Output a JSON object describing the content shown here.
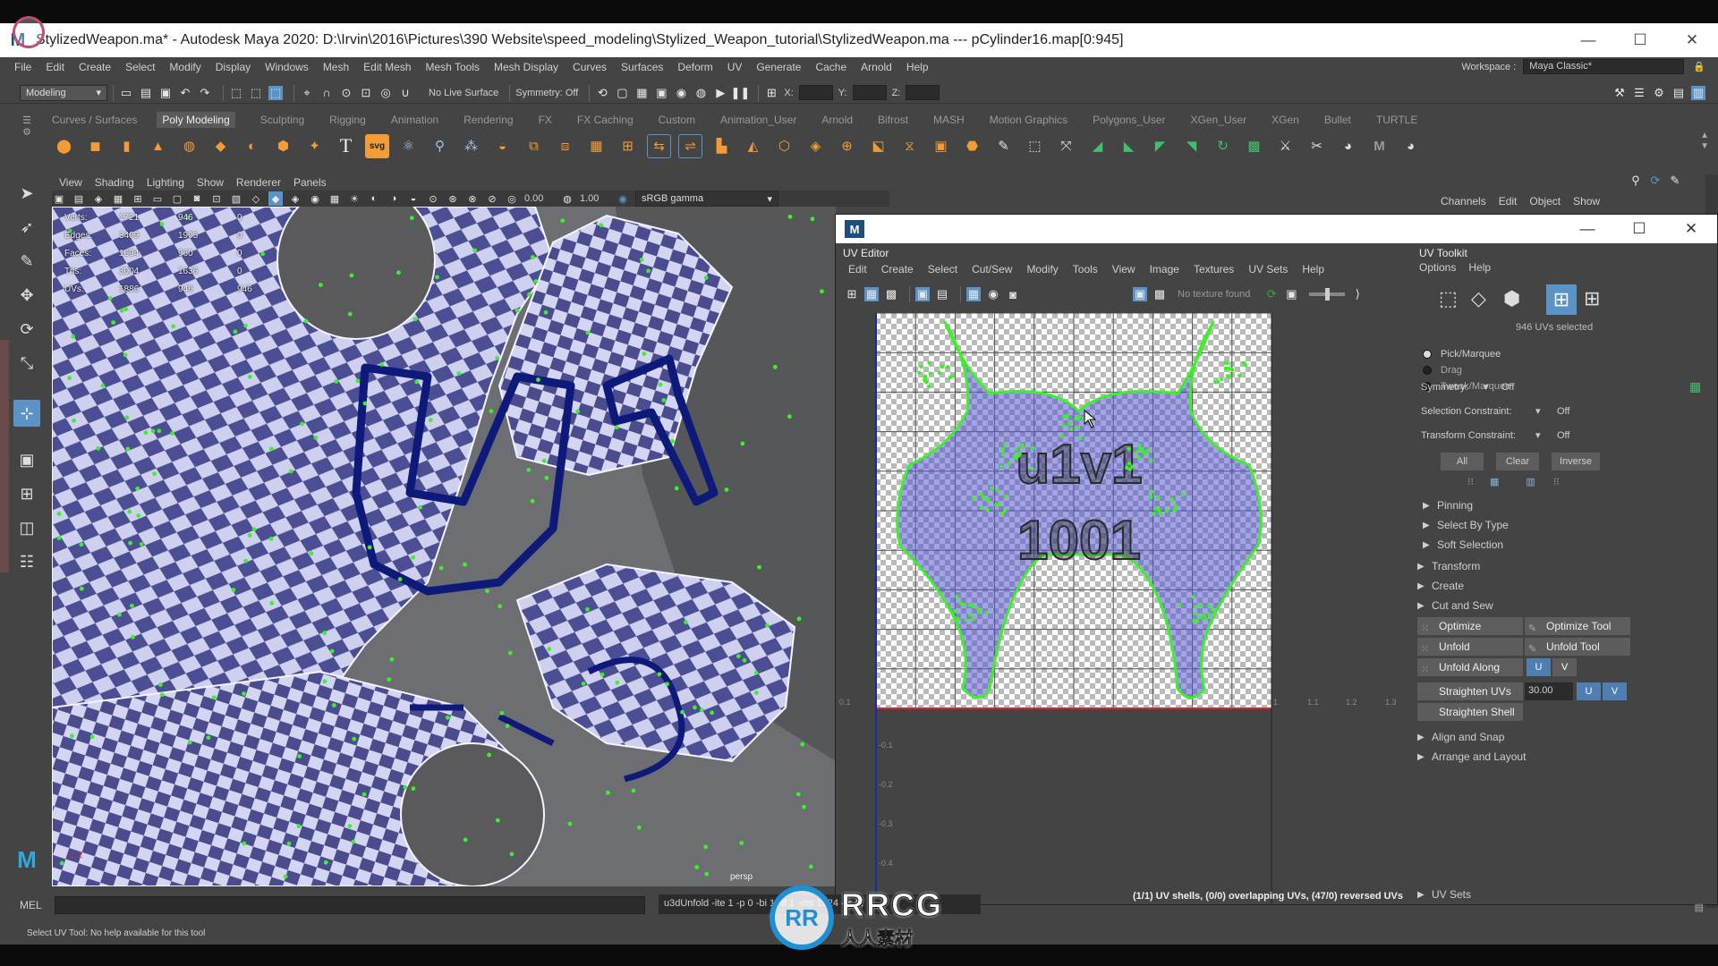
{
  "window": {
    "title": "StylizedWeapon.ma* - Autodesk Maya 2020: D:\\Irvin\\2016\\Pictures\\390 Website\\speed_modeling\\Stylized_Weapon_tutorial\\StylizedWeapon.ma  ---  pCylinder16.map[0:945]",
    "minimize": "—",
    "maximize": "☐",
    "close": "✕",
    "logo": "M"
  },
  "menubar": {
    "items": [
      "File",
      "Edit",
      "Create",
      "Select",
      "Modify",
      "Display",
      "Windows",
      "Mesh",
      "Edit Mesh",
      "Mesh Tools",
      "Mesh Display",
      "Curves",
      "Surfaces",
      "Deform",
      "UV",
      "Generate",
      "Cache",
      "Arnold",
      "Help"
    ],
    "workspace_label": "Workspace :",
    "workspace_value": "Maya Classic*"
  },
  "statusline": {
    "mode": "Modeling",
    "live_surface": "No Live Surface",
    "symmetry": "Symmetry: Off",
    "x_label": "X:",
    "y_label": "Y:",
    "z_label": "Z:"
  },
  "shelf": {
    "tabs": [
      "Curves / Surfaces",
      "Poly Modeling",
      "Sculpting",
      "Rigging",
      "Animation",
      "Rendering",
      "FX",
      "FX Caching",
      "Custom",
      "Animation_User",
      "Arnold",
      "Bifrost",
      "MASH",
      "Motion Graphics",
      "Polygons_User",
      "XGen_User",
      "XGen",
      "Bullet",
      "TURTLE"
    ],
    "active_tab": "Poly Modeling",
    "svg_label": "svg"
  },
  "viewport": {
    "menu": [
      "View",
      "Shading",
      "Lighting",
      "Show",
      "Renderer",
      "Panels"
    ],
    "exposure": "0.00",
    "gamma": "1.00",
    "color_space": "sRGB gamma",
    "camera": "persp",
    "hud": [
      {
        "label": "Verts:",
        "a": "1721",
        "b": "946",
        "c": "0"
      },
      {
        "label": "Edges:",
        "a": "3409",
        "b": "1905",
        "c": "0"
      },
      {
        "label": "Faces:",
        "a": "1694",
        "b": "960",
        "c": "0"
      },
      {
        "label": "Tris:",
        "a": "3004",
        "b": "1636",
        "c": "0"
      },
      {
        "label": "UVs:",
        "a": "1886",
        "b": "946",
        "c": "946"
      }
    ]
  },
  "channels": {
    "items": [
      "Channels",
      "Edit",
      "Object",
      "Show"
    ]
  },
  "uv_editor": {
    "window_logo": "M",
    "header": "UV Editor",
    "menu": [
      "Edit",
      "Create",
      "Select",
      "Cut/Sew",
      "Modify",
      "Tools",
      "View",
      "Image",
      "Textures",
      "UV Sets",
      "Help"
    ],
    "texture_status": "No texture found",
    "status": "(1/1) UV shells, (0/0) overlapping UVs, (47/0) reversed UVs",
    "grid_labels_x": [
      "0.1",
      "1",
      "1.1",
      "1.2",
      "1.3"
    ],
    "grid_labels_y": [
      "-0.1",
      "-0.2",
      "-0.3",
      "-0.4"
    ],
    "tile_text_top": "u1v1",
    "tile_text_bottom": "1001"
  },
  "toolkit": {
    "header": "UV Toolkit",
    "menu": [
      "Options",
      "Help"
    ],
    "selected_count": "946 UVs selected",
    "modes": [
      {
        "label": "Pick/Marquee",
        "on": true
      },
      {
        "label": "Drag",
        "on": false
      },
      {
        "label": "Tweak/Marquee",
        "on": false
      }
    ],
    "symmetry_label": "Symmetry:",
    "symmetry_value": "Off",
    "selection_constraint_label": "Selection Constraint:",
    "selection_constraint_value": "Off",
    "transform_constraint_label": "Transform Constraint:",
    "transform_constraint_value": "Off",
    "select_buttons": [
      "All",
      "Clear",
      "Inverse"
    ],
    "sub_sections": [
      "Pinning",
      "Select By Type",
      "Soft Selection"
    ],
    "sections": [
      "Transform",
      "Create",
      "Cut and Sew",
      "Unfold"
    ],
    "unfold_buttons": {
      "optimize": "Optimize",
      "optimize_tool": "Optimize Tool",
      "unfold": "Unfold",
      "unfold_tool": "Unfold Tool",
      "unfold_along": "Unfold Along",
      "u": "U",
      "v": "V",
      "straighten_uvs": "Straighten UVs",
      "straighten_value": "30.00",
      "straighten_shell": "Straighten Shell"
    },
    "more_sections": [
      "Align and Snap",
      "Arrange and Layout"
    ],
    "uv_sets": "UV Sets"
  },
  "cmdline": {
    "label": "MEL",
    "result": "u3dUnfold -ite 1 -p 0 -bi 1 -tf 1 -ms 1024 -rs 0;"
  },
  "helpline": "Select UV Tool: No help available for this tool",
  "watermark": {
    "mark": "RR",
    "brand": "RRCG",
    "sub": "人人素材"
  },
  "colors": {
    "accent": "#5b93c7",
    "uv_green": "#3cf02a",
    "checker_light": "#cfd0f0",
    "checker_dark": "#4b4e92",
    "outline_navy": "#0d1a7a"
  }
}
